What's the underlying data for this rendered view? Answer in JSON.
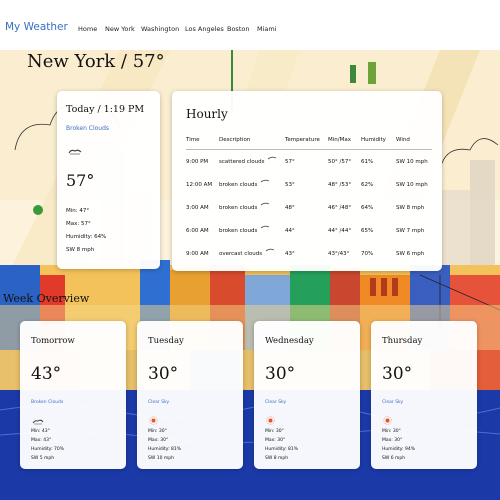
{
  "app": {
    "brand": "My Weather"
  },
  "nav": {
    "links": [
      "Home",
      "New York",
      "Washington",
      "Los Angeles",
      "Boston",
      "Miami"
    ]
  },
  "page": {
    "title": "New York / 57°"
  },
  "today": {
    "title": "Today / 1:19 PM",
    "condition": "Broken Clouds",
    "icon": "broken-clouds-icon",
    "temp": "57°",
    "min": "Min: 47°",
    "max": "Max: 57°",
    "humidity": "Humidity: 64%",
    "wind": "SW 8 mph"
  },
  "hourly": {
    "title": "Hourly",
    "columns": [
      "Time",
      "Description",
      "Temperature",
      "Min/Max",
      "Humidity",
      "Wind"
    ],
    "rows": [
      {
        "time": "9:00 PM",
        "desc": "scattered clouds",
        "icon": "scattered-clouds-icon",
        "temp": "57°",
        "minmax": "50° /57°",
        "humidity": "61%",
        "wind": "SW 10 mph"
      },
      {
        "time": "12:00 AM",
        "desc": "broken clouds",
        "icon": "broken-clouds-icon",
        "temp": "53°",
        "minmax": "48° /53°",
        "humidity": "62%",
        "wind": "SW 10 mph"
      },
      {
        "time": "3:00 AM",
        "desc": "broken clouds",
        "icon": "broken-clouds-icon",
        "temp": "48°",
        "minmax": "46° /48°",
        "humidity": "64%",
        "wind": "SW 8 mph"
      },
      {
        "time": "6:00 AM",
        "desc": "broken clouds",
        "icon": "broken-clouds-icon",
        "temp": "44°",
        "minmax": "44° /44°",
        "humidity": "65%",
        "wind": "SW 7 mph"
      },
      {
        "time": "9:00 AM",
        "desc": "overcast clouds",
        "icon": "overcast-clouds-icon",
        "temp": "43°",
        "minmax": "43°/43°",
        "humidity": "70%",
        "wind": "SW 6 mph"
      }
    ]
  },
  "week": {
    "title": "Week Overview",
    "days": [
      {
        "name": "Tomorrow",
        "temp": "43°",
        "condition": "Broken Clouds",
        "icon": "broken-clouds-icon",
        "min": "Min: 43°",
        "max": "Max: 43°",
        "humidity": "Humidity: 70%",
        "wind": "SW 5 mph"
      },
      {
        "name": "Tuesday",
        "temp": "30°",
        "condition": "Clear Sky",
        "icon": "sun-icon",
        "min": "Min: 30°",
        "max": "Max: 30°",
        "humidity": "Humidity: 81%",
        "wind": "SW 10 mph"
      },
      {
        "name": "Wednesday",
        "temp": "30°",
        "condition": "Clear Sky",
        "icon": "sun-icon",
        "min": "Min: 30°",
        "max": "Max: 30°",
        "humidity": "Humidity: 81%",
        "wind": "SW 8 mph"
      },
      {
        "name": "Thursday",
        "temp": "30°",
        "condition": "Clear Sky",
        "icon": "sun-icon",
        "min": "Min: 30°",
        "max": "Max: 30°",
        "humidity": "Humidity: 94%",
        "wind": "SW 6 mph"
      }
    ]
  },
  "colors": {
    "accent": "#3a6fbf",
    "sun": "#e8542a",
    "ocean": "#1b3aa8"
  }
}
